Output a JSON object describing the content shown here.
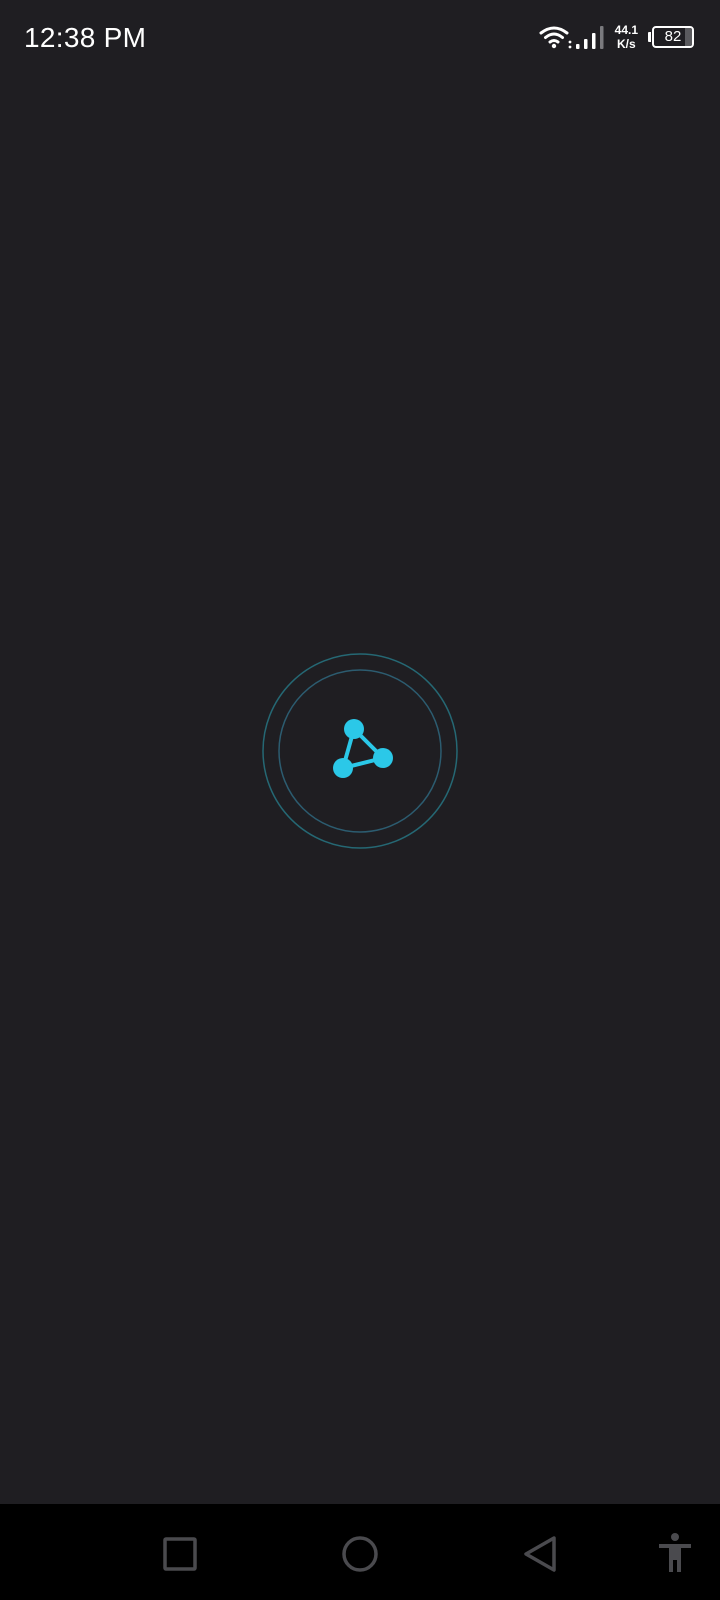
{
  "status_bar": {
    "time": "12:38 PM",
    "net_speed_value": "44.1",
    "net_speed_unit": "K/s",
    "battery_level": "82",
    "battery_fraction": 0.82,
    "icons": [
      "wifi-icon",
      "signal-icon",
      "battery-icon"
    ]
  },
  "loader": {
    "icon": "network-nodes-icon",
    "accent_color": "#2bc8e8",
    "ring_color": "#2a6b7a"
  },
  "nav_bar": {
    "icons": [
      "recent-apps-icon",
      "home-icon",
      "back-icon",
      "accessibility-icon"
    ]
  },
  "colors": {
    "background": "#1f1e22",
    "nav_background": "#000000"
  }
}
